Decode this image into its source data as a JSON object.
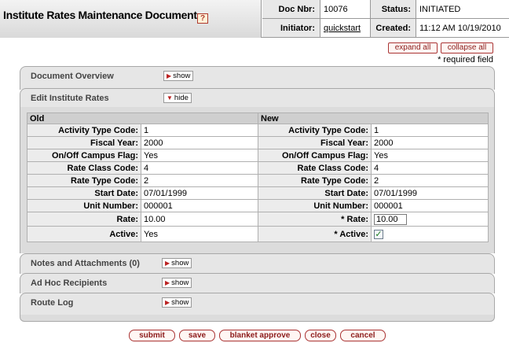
{
  "header": {
    "title": "Institute Rates Maintenance Document",
    "doc_nbr_label": "Doc Nbr:",
    "doc_nbr": "10076",
    "status_label": "Status:",
    "status": "INITIATED",
    "initiator_label": "Initiator:",
    "initiator": "quickstart",
    "created_label": "Created:",
    "created": "11:12 AM 10/19/2010",
    "help_icon": "?"
  },
  "controls": {
    "expand_all": "expand all",
    "collapse_all": "collapse all",
    "required_note": "* required field"
  },
  "tabs": {
    "document_overview": {
      "label": "Document Overview",
      "toggle": "show"
    },
    "edit_rates": {
      "label": "Edit Institute Rates",
      "toggle": "hide"
    },
    "notes": {
      "label": "Notes and Attachments (0)",
      "toggle": "show"
    },
    "adhoc": {
      "label": "Ad Hoc Recipients",
      "toggle": "show"
    },
    "route_log": {
      "label": "Route Log",
      "toggle": "show"
    }
  },
  "table": {
    "old_header": "Old",
    "new_header": "New",
    "rows": [
      {
        "old_label": "Activity Type Code:",
        "old_value": "1",
        "new_label": "Activity Type Code:",
        "new_value": "1"
      },
      {
        "old_label": "Fiscal Year:",
        "old_value": "2000",
        "new_label": "Fiscal Year:",
        "new_value": "2000"
      },
      {
        "old_label": "On/Off Campus Flag:",
        "old_value": "Yes",
        "new_label": "On/Off Campus Flag:",
        "new_value": "Yes"
      },
      {
        "old_label": "Rate Class Code:",
        "old_value": "4",
        "new_label": "Rate Class Code:",
        "new_value": "4"
      },
      {
        "old_label": "Rate Type Code:",
        "old_value": "2",
        "new_label": "Rate Type Code:",
        "new_value": "2"
      },
      {
        "old_label": "Start Date:",
        "old_value": "07/01/1999",
        "new_label": "Start Date:",
        "new_value": "07/01/1999"
      },
      {
        "old_label": "Unit Number:",
        "old_value": "000001",
        "new_label": "Unit Number:",
        "new_value": "000001"
      },
      {
        "old_label": "Rate:",
        "old_value": "10.00",
        "new_label": "*  Rate:",
        "new_value": "10.00"
      },
      {
        "old_label": "Active:",
        "old_value": "Yes",
        "new_label": "*  Active:",
        "new_value": "✓"
      }
    ]
  },
  "actions": {
    "submit": "submit",
    "save": "save",
    "blanket_approve": "blanket approve",
    "close": "close",
    "cancel": "cancel"
  },
  "icons": {
    "toggle_arrow": "▶",
    "toggle_arrow_down": "▼"
  },
  "colors": {
    "button_border": "#aa3333",
    "button_text": "#8b1a1a",
    "tab_bg": "#e6e6e6"
  }
}
